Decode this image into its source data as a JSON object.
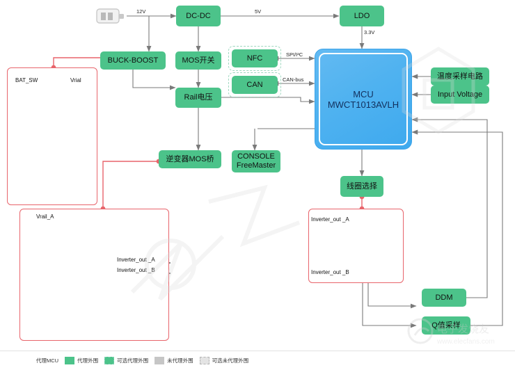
{
  "blocks": {
    "dcdc": "DC-DC",
    "ldo": "LDO",
    "buck_boost": "BUCK-BOOST",
    "mos_switch": "MOS开关",
    "nfc": "NFC",
    "can": "CAN",
    "rail_voltage": "Rail电压",
    "inverter_mos": "逆变器MOS桥",
    "console": "CONSOLE",
    "console2": "FreeMaster",
    "coil_select": "线圈选择",
    "temp_sample": "温度采样电路",
    "input_voltage": "Input Voltage",
    "ddm": "DDM",
    "q_sample": "Q值采样"
  },
  "mcu": {
    "line1": "MCU",
    "line2": "MWCT1013AVLH"
  },
  "wire_labels": {
    "v12": "12V",
    "v5": "5V",
    "v33": "3.3V",
    "spi_i2c": "SPI/I²C",
    "can_bus": "CAN-bus"
  },
  "nets": {
    "bat_sw": "BAT_SW",
    "vrial": "Vrial",
    "vrail_a": "Vrail_A",
    "inv_out_a": "Inverter_out _A",
    "inv_out_b": "Inverter_out _B",
    "coil_in_a": "Inverter_out _A",
    "coil_in_b": "Inverter_out _B"
  },
  "legend": [
    {
      "label": "代理MCU",
      "style": "mcu"
    },
    {
      "label": "代理外围",
      "style": "green"
    },
    {
      "label": "可选代理外围",
      "style": "green-dashed"
    },
    {
      "label": "未代理外围",
      "style": "gray"
    },
    {
      "label": "可选未代理外围",
      "style": "gray-dashed"
    }
  ],
  "watermark": {
    "text": "电子发烧友",
    "url": "www.elecfans.com"
  },
  "colors": {
    "green": "#4cc38a",
    "mcu_blue": "#4fb2f0",
    "link_red": "#e8646b",
    "wire_gray": "#7a7a7a"
  }
}
